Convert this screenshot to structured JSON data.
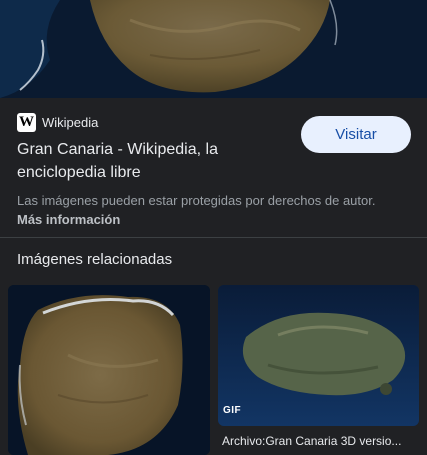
{
  "source": {
    "logo_letter": "W",
    "name": "Wikipedia"
  },
  "result": {
    "title": "Gran Canaria - Wikipedia, la enciclopedia libre",
    "visit_label": "Visitar"
  },
  "notice": {
    "text": "Las imágenes pueden estar protegidas por derechos de autor.",
    "more_label": "Más información"
  },
  "related": {
    "heading": "Imágenes relacionadas",
    "items": [
      {
        "badge": "",
        "caption": ""
      },
      {
        "badge": "GIF",
        "caption": "Archivo:Gran Canaria 3D versio..."
      }
    ]
  },
  "colors": {
    "background": "#202124",
    "button_bg": "#e8f0fe",
    "button_text": "#174ea6"
  }
}
